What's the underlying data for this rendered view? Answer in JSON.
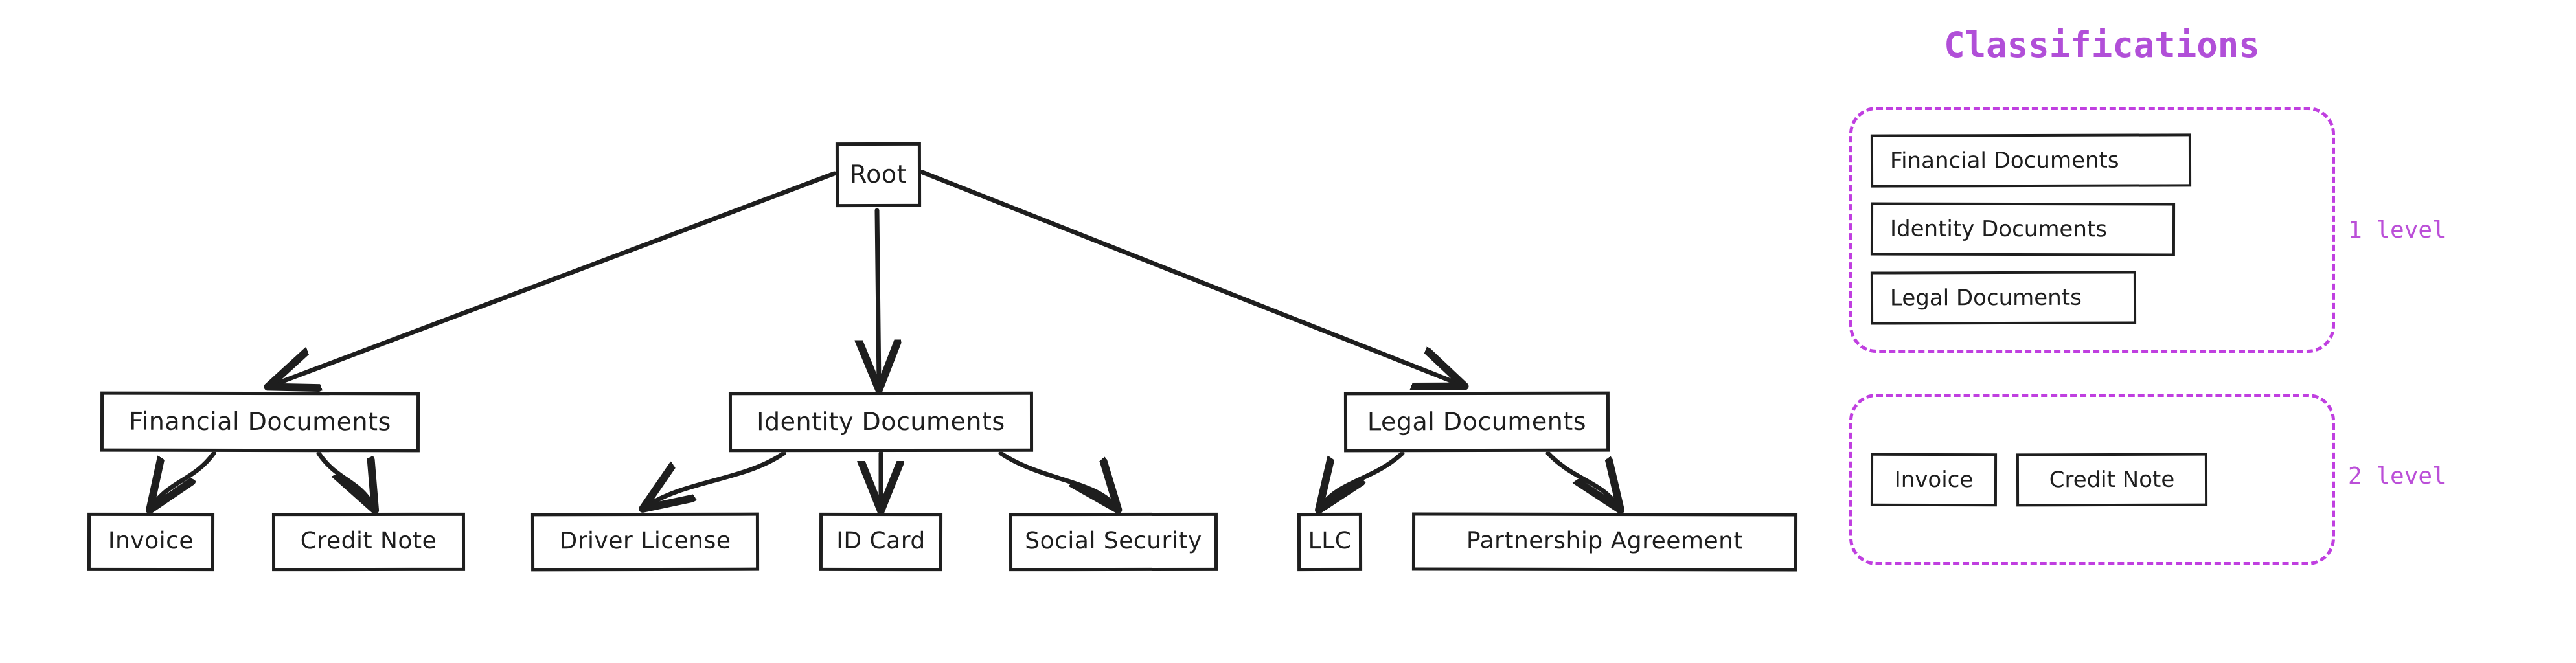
{
  "diagram": {
    "title_hidden": "",
    "accent_color": "#b14fd8",
    "ink_color": "#1e1e1e",
    "nodes": {
      "root": "Root",
      "financial_documents": "Financial Documents",
      "identity_documents": "Identity Documents",
      "legal_documents": "Legal Documents",
      "invoice": "Invoice",
      "credit_note": "Credit Note",
      "driver_license": "Driver License",
      "id_card": "ID Card",
      "social_security": "Social Security",
      "llc": "LLC",
      "partnership_agreement": "Partnership Agreement"
    },
    "edges": [
      {
        "from": "Root",
        "to": "Financial Documents"
      },
      {
        "from": "Root",
        "to": "Identity Documents"
      },
      {
        "from": "Root",
        "to": "Legal Documents"
      },
      {
        "from": "Financial Documents",
        "to": "Invoice"
      },
      {
        "from": "Financial Documents",
        "to": "Credit Note"
      },
      {
        "from": "Identity Documents",
        "to": "Driver License"
      },
      {
        "from": "Identity Documents",
        "to": "ID Card"
      },
      {
        "from": "Identity Documents",
        "to": "Social Security"
      },
      {
        "from": "Legal Documents",
        "to": "LLC"
      },
      {
        "from": "Legal Documents",
        "to": "Partnership Agreement"
      }
    ]
  },
  "panel": {
    "title": "Classifications",
    "groups": [
      {
        "level_label": "1 level",
        "items": [
          "Financial Documents",
          "Identity Documents",
          "Legal Documents"
        ]
      },
      {
        "level_label": "2 level",
        "items": [
          "Invoice",
          "Credit Note"
        ]
      }
    ]
  }
}
